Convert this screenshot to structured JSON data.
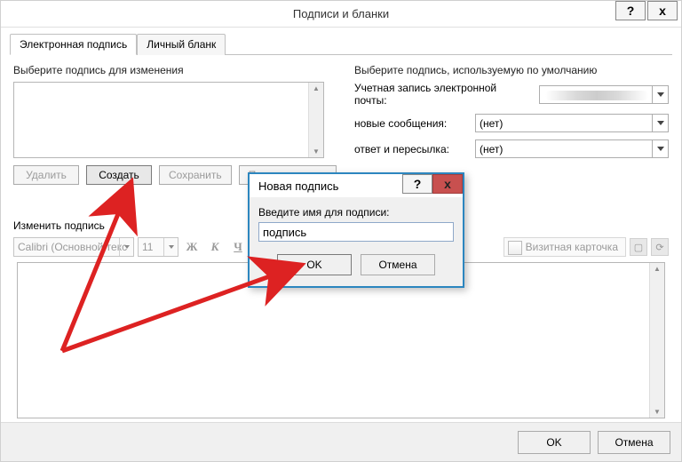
{
  "window": {
    "title": "Подписи и бланки",
    "help_glyph": "?",
    "close_glyph": "x"
  },
  "tabs": {
    "signature": "Электронная подпись",
    "personal": "Личный бланк"
  },
  "left": {
    "choose_label": "Выберите подпись для изменения",
    "buttons": {
      "delete": "Удалить",
      "create": "Создать",
      "save": "Сохранить",
      "rename": "Переименовать"
    },
    "edit_label": "Изменить подпись"
  },
  "right": {
    "default_label": "Выберите подпись, используемую по умолчанию",
    "account_label": "Учетная запись электронной почты:",
    "new_label": "новые сообщения:",
    "reply_label": "ответ и пересылка:",
    "none": "(нет)"
  },
  "toolbar": {
    "font_name": "Calibri (Основной текс",
    "font_size": "11",
    "bold": "Ж",
    "italic": "К",
    "underline": "Ч",
    "business_card": "Визитная карточка"
  },
  "footer": {
    "ok": "OK",
    "cancel": "Отмена"
  },
  "modal": {
    "title": "Новая подпись",
    "help_glyph": "?",
    "close_glyph": "x",
    "prompt": "Введите имя для подписи:",
    "value": "подпись",
    "ok": "OK",
    "cancel": "Отмена"
  }
}
